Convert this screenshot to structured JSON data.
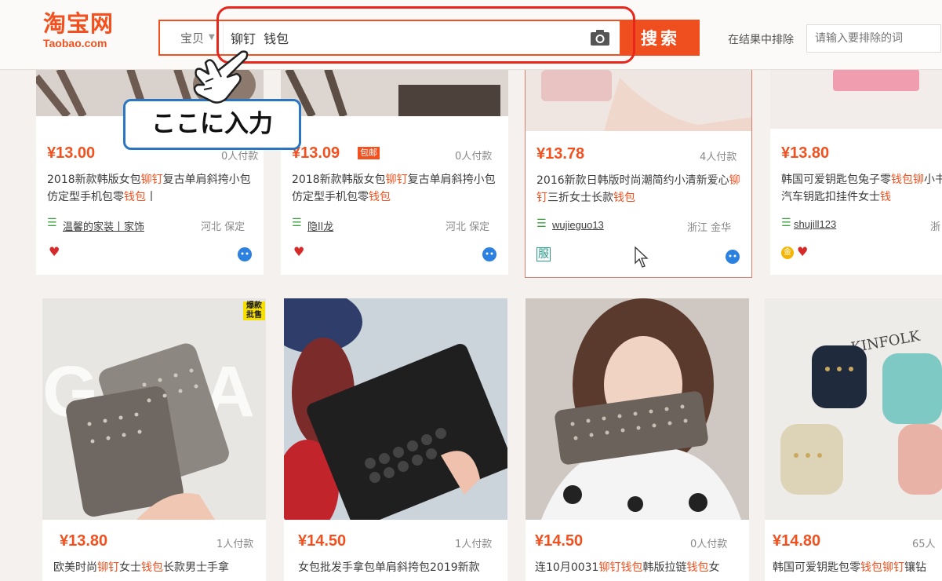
{
  "header": {
    "logo_cn": "淘宝网",
    "logo_en": "Taobao.com",
    "category": "宝贝",
    "query": "铆钉  钱包",
    "search_button": "搜索",
    "exclude_label": "在结果中排除",
    "exclude_placeholder": "请输入要排除的词",
    "accent_color": "#f2511f"
  },
  "callout": {
    "text": "ここに入力"
  },
  "products_row1": [
    {
      "price": "¥13.00",
      "sales": "0人付款",
      "title_a": "2018新款韩版女包",
      "hl1": "铆钉",
      "title_b": "复古单肩斜挎小包仿定型手机包零",
      "hl2": "钱包",
      "title_c": "丨",
      "shop": "温馨的家装丨家饰",
      "location": "河北 保定"
    },
    {
      "price": "¥13.09",
      "badge": "包邮",
      "sales": "0人付款",
      "title_a": "2018新款韩版女包",
      "hl1": "铆钉",
      "title_b": "复古单肩斜挎小包仿定型手机包零",
      "hl2": "钱包",
      "title_c": "",
      "shop": "隐ll龙",
      "location": "河北 保定"
    },
    {
      "price": "¥13.78",
      "sales": "4人付款",
      "title_a": "2016新款日韩版时尚潮简约小清新爱心",
      "hl1": "铆钉",
      "title_b": "三折女士长款",
      "hl2": "钱包",
      "title_c": "",
      "shop": "wujieguo13",
      "location": "浙江 金华",
      "tag": "服"
    },
    {
      "price": "¥13.80",
      "sales": "",
      "title_a": "韩国可爱钥匙包兔子零",
      "hl1": "钱包铆",
      "title_b": "小书包汽车钥匙扣挂件女士",
      "hl2": "钱",
      "title_c": "",
      "shop": "shujill123",
      "location": "浙"
    }
  ],
  "products_row2": [
    {
      "price": "¥13.80",
      "sales": "1人付款",
      "title_a": "欧美时尚",
      "hl1": "铆钉",
      "title_b": "女士",
      "hl2": "钱包",
      "title_c": "长款男士手拿",
      "promo": "爆款批售"
    },
    {
      "price": "¥14.50",
      "sales": "1人付款",
      "title_a": "女包批发手拿包单肩斜挎包2019新款",
      "hl1": "",
      "title_b": "",
      "hl2": "",
      "title_c": ""
    },
    {
      "price": "¥14.50",
      "sales": "0人付款",
      "title_a": "连10月0031",
      "hl1": "铆钉钱包",
      "title_b": "韩版拉链",
      "hl2": "钱包",
      "title_c": "女"
    },
    {
      "price": "¥14.80",
      "sales": "65人",
      "title_a": "韩国可爱钥匙包零",
      "hl1": "钱包铆钉",
      "title_b": "镶钻",
      "hl2": "",
      "title_c": "",
      "brand_text": "KINFOLK"
    }
  ]
}
